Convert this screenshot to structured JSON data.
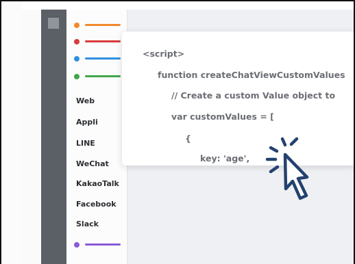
{
  "sidebar": {
    "legend_top": [
      {
        "color": "#f08a2c"
      },
      {
        "color": "#d93a3a"
      },
      {
        "color": "#2f8fe0"
      },
      {
        "color": "#3fa64a"
      }
    ],
    "channels": [
      "Web",
      "Appli",
      "LINE",
      "WeChat",
      "KakaoTalk",
      "Facebook",
      "Slack"
    ],
    "legend_bottom": [
      {
        "color": "#8a5ad6"
      }
    ]
  },
  "code": {
    "lines": [
      "<script>",
      "function createChatViewCustomValues",
      "// Create a custom Value object to",
      "var customValues = [",
      "{",
      "key: 'age',"
    ]
  },
  "cursor": {
    "icon": "pointer-cursor-icon",
    "color": "#24426f"
  }
}
